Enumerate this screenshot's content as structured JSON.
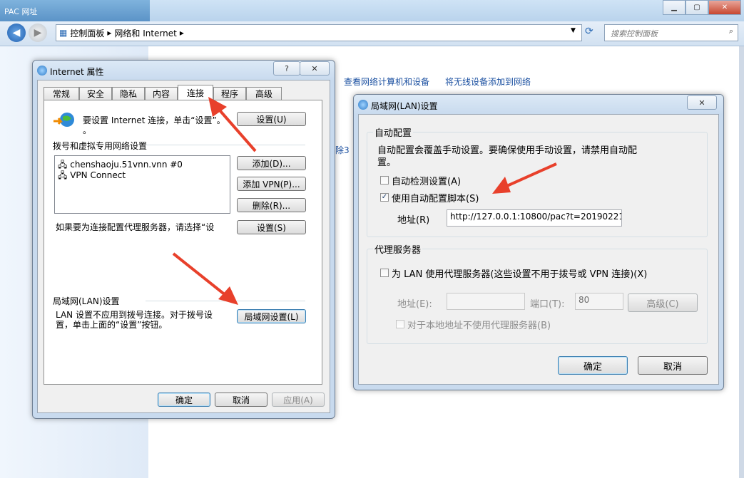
{
  "explorer": {
    "title": "PAC 网址",
    "breadcrumb": [
      "控制面板",
      "网络和 Internet"
    ],
    "search_placeholder": "搜索控制面板",
    "links": [
      "查看网络计算机和设备",
      "将无线设备添加到网络"
    ],
    "partial_link": "除3"
  },
  "inet": {
    "title": "Internet 属性",
    "help": "?",
    "close": "✕",
    "tabs": [
      "常规",
      "安全",
      "隐私",
      "内容",
      "连接",
      "程序",
      "高级"
    ],
    "active_tab": "连接",
    "setup_text": "要设置 Internet 连接，单击“设置”。",
    "setup_text_cont": "。",
    "setup_btn": "设置(U)",
    "dialup_group": "拨号和虚拟专用网络设置",
    "connections": [
      "chenshaoju.51vnn.vnn #0",
      "VPN Connect"
    ],
    "add_btn": "添加(D)...",
    "add_vpn_btn": "添加 VPN(P)...",
    "remove_btn": "删除(R)...",
    "proxy_text": "如果要为连接配置代理服务器，请选择“设",
    "settings_btn": "设置(S)",
    "lan_group": "局域网(LAN)设置",
    "lan_text_1": "LAN 设置不应用到拨号连接。对于拨号设",
    "lan_text_2": "置，单击上面的“设置”按钮。",
    "lan_btn": "局域网设置(L)",
    "ok": "确定",
    "cancel": "取消",
    "apply": "应用(A)"
  },
  "lan": {
    "title": "局域网(LAN)设置",
    "close": "✕",
    "auto_group": "自动配置",
    "auto_desc_1": "自动配置会覆盖手动设置。要确保使用手动设置，请禁用自动配",
    "auto_desc_2": "置。",
    "auto_detect": "自动检测设置(A)",
    "auto_detect_checked": false,
    "use_script": "使用自动配置脚本(S)",
    "use_script_checked": true,
    "address_label": "地址(R)",
    "address_value": "http://127.0.0.1:10800/pac?t=20190221",
    "proxy_group": "代理服务器",
    "use_proxy": "为 LAN 使用代理服务器(这些设置不用于拨号或 VPN 连接)(X)",
    "use_proxy_checked": false,
    "proxy_address_label": "地址(E):",
    "proxy_port_label": "端口(T):",
    "proxy_port_value": "80",
    "advanced": "高级(C)",
    "bypass_local": "对于本地地址不使用代理服务器(B)",
    "bypass_local_checked": false,
    "ok": "确定",
    "cancel": "取消"
  },
  "colors": {
    "annotation_arrow": "#e8402b",
    "link": "#1a4fa0",
    "dialog_bg": "#f0f0f0"
  }
}
